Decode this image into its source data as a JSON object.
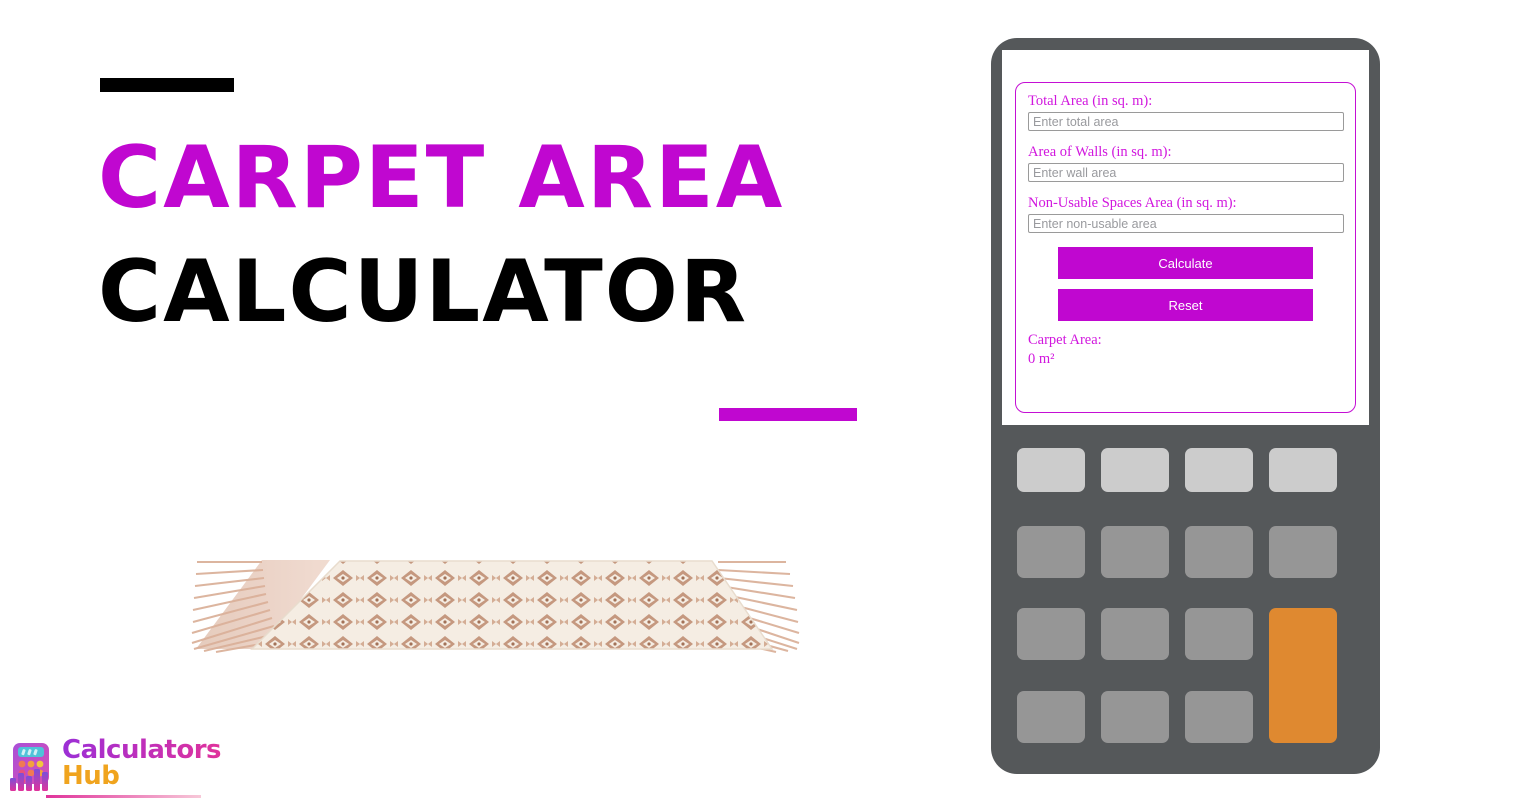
{
  "promo": {
    "title_line_1": "Carpet Area",
    "title_line_2": "Calculator",
    "accent_bar_top_color": "#000000",
    "accent_bar_bottom_color": "#C007D0",
    "title_accent_color": "#C007D0",
    "title_base_color": "#000000"
  },
  "illustration": {
    "name": "carpet-rug",
    "base_color": "#F3EADF",
    "pattern_color": "#B07A5C",
    "fringe_color": "#D8A489"
  },
  "logo": {
    "word_1": "Calculators",
    "word_2": "Hub",
    "word_1_color": "#B02FC4",
    "word_2_color": "#F0A41E",
    "icon_name": "calculator-bars-logo-icon"
  },
  "device": {
    "body_color": "#55585A",
    "screen_color": "#FFFFFF",
    "panel_border_color": "#C40FD4"
  },
  "form": {
    "fields": [
      {
        "id": "total-area",
        "label": "Total Area (in sq. m):",
        "placeholder": "Enter total area",
        "value": ""
      },
      {
        "id": "wall-area",
        "label": "Area of Walls (in sq. m):",
        "placeholder": "Enter wall area",
        "value": ""
      },
      {
        "id": "non-usable-area",
        "label": "Non-Usable Spaces Area (in sq. m):",
        "placeholder": "Enter non-usable area",
        "value": ""
      }
    ],
    "buttons": {
      "calculate": "Calculate",
      "reset": "Reset",
      "color": "#C007D0",
      "text_color": "#FFFFFF"
    },
    "result": {
      "label": "Carpet Area:",
      "value": "0 m²",
      "color": "#D116DE"
    }
  },
  "keypad": {
    "rows": 4,
    "cols": 4,
    "top_row_color": "#CCCCCC",
    "key_color": "#969696",
    "accent_key_color": "#DF8930",
    "accent_key_position": "col-4-rows-3-4"
  }
}
